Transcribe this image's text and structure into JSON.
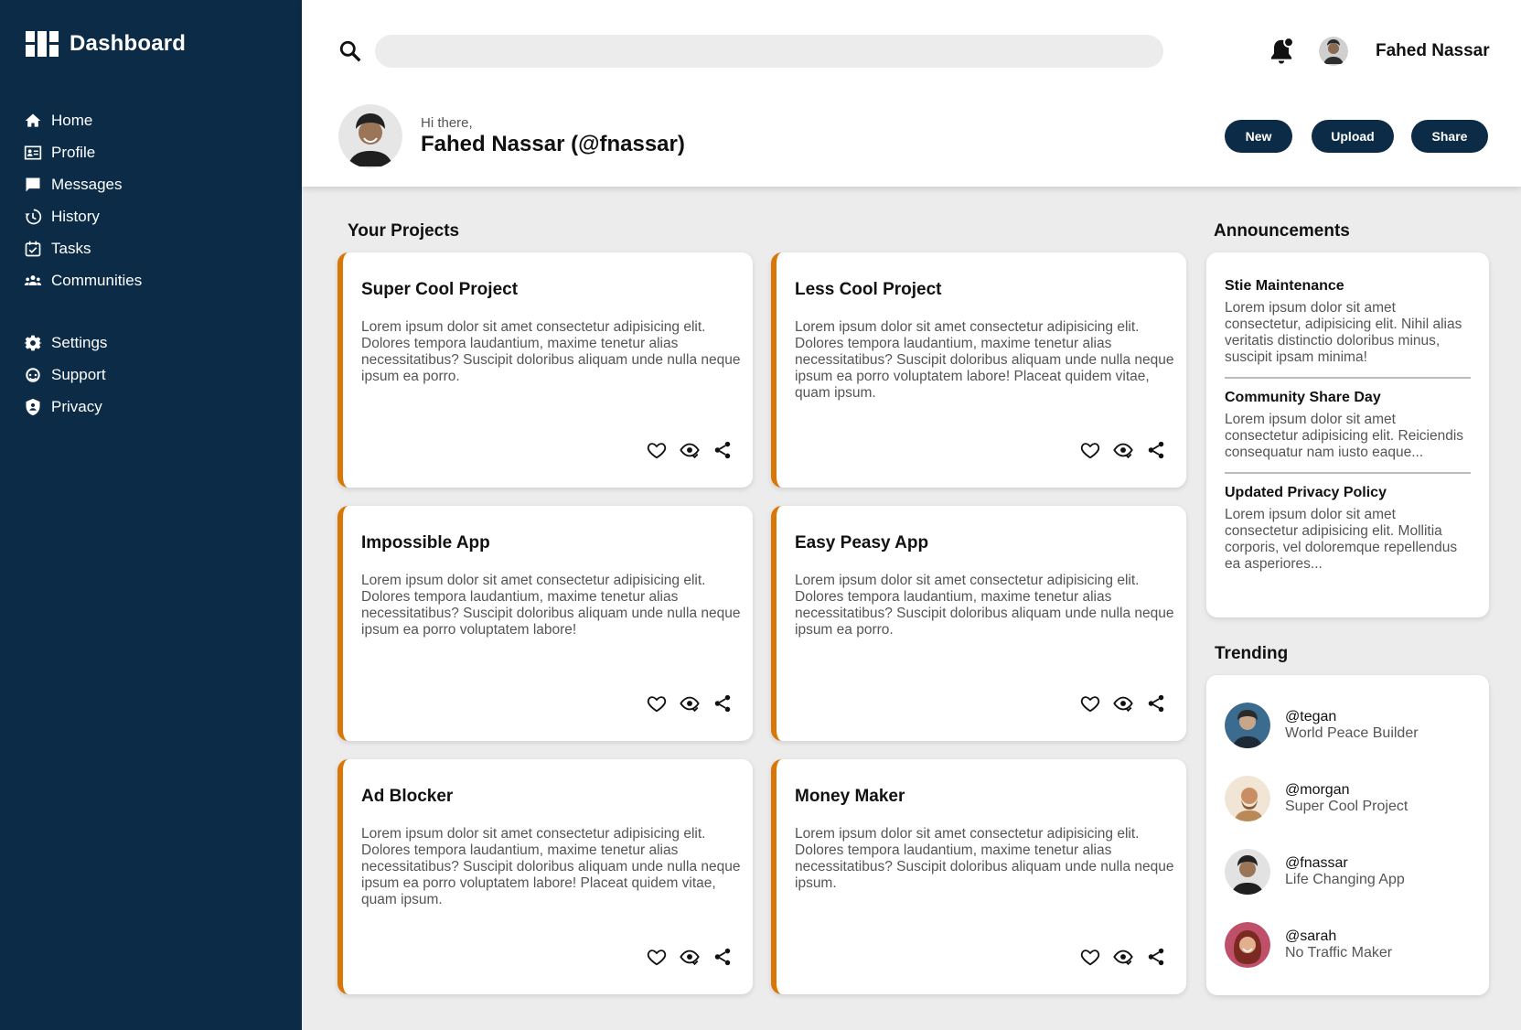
{
  "sidebar": {
    "title": "Dashboard",
    "items": [
      {
        "label": "Home",
        "icon": "home-icon"
      },
      {
        "label": "Profile",
        "icon": "profile-card-icon"
      },
      {
        "label": "Messages",
        "icon": "message-icon"
      },
      {
        "label": "History",
        "icon": "history-icon"
      },
      {
        "label": "Tasks",
        "icon": "calendar-check-icon"
      },
      {
        "label": "Communities",
        "icon": "group-icon"
      }
    ],
    "settings_items": [
      {
        "label": "Settings",
        "icon": "gear-icon"
      },
      {
        "label": "Support",
        "icon": "support-icon"
      },
      {
        "label": "Privacy",
        "icon": "shield-user-icon"
      }
    ]
  },
  "header": {
    "search_value": "",
    "user_name": "Fahed Nassar",
    "greeting": "Hi there,",
    "profile_name": "Fahed Nassar (@fnassar)",
    "buttons": {
      "new": "New",
      "upload": "Upload",
      "share": "Share"
    }
  },
  "projects": {
    "title": "Your Projects",
    "items": [
      {
        "title": "Super Cool Project",
        "description": "Lorem ipsum dolor sit amet consectetur adipisicing elit. Dolores tempora laudantium, maxime tenetur alias necessitatibus? Suscipit doloribus aliquam unde nulla neque ipsum ea porro."
      },
      {
        "title": "Less Cool Project",
        "description": "Lorem ipsum dolor sit amet consectetur adipisicing elit. Dolores tempora laudantium, maxime tenetur alias necessitatibus? Suscipit doloribus aliquam unde nulla neque ipsum ea porro voluptatem labore! Placeat quidem vitae, quam ipsum."
      },
      {
        "title": "Impossible App",
        "description": "Lorem ipsum dolor sit amet consectetur adipisicing elit. Dolores tempora laudantium, maxime tenetur alias necessitatibus? Suscipit doloribus aliquam unde nulla neque ipsum ea porro voluptatem labore!"
      },
      {
        "title": "Easy Peasy App",
        "description": "Lorem ipsum dolor sit amet consectetur adipisicing elit. Dolores tempora laudantium, maxime tenetur alias necessitatibus? Suscipit doloribus aliquam unde nulla neque ipsum ea porro."
      },
      {
        "title": "Ad Blocker",
        "description": "Lorem ipsum dolor sit amet consectetur adipisicing elit. Dolores tempora laudantium, maxime tenetur alias necessitatibus? Suscipit doloribus aliquam unde nulla neque ipsum ea porro voluptatem labore! Placeat quidem vitae, quam ipsum."
      },
      {
        "title": "Money Maker",
        "description": "Lorem ipsum dolor sit amet consectetur adipisicing elit. Dolores tempora laudantium, maxime tenetur alias necessitatibus? Suscipit doloribus aliquam unde nulla neque ipsum."
      }
    ],
    "action_icons": [
      "heart-icon",
      "eye-icon",
      "share-icon"
    ]
  },
  "announcements": {
    "title": "Announcements",
    "items": [
      {
        "title": "Stie Maintenance",
        "text": "Lorem ipsum dolor sit amet consectetur, adipisicing elit. Nihil alias veritatis distinctio doloribus minus, suscipit ipsam minima!"
      },
      {
        "title": "Community Share Day",
        "text": "Lorem ipsum dolor sit amet consectetur adipisicing elit. Reiciendis consequatur nam iusto eaque..."
      },
      {
        "title": "Updated Privacy Policy",
        "text": "Lorem ipsum dolor sit amet consectetur adipisicing elit. Mollitia corporis, vel doloremque repellendus ea asperiores..."
      }
    ]
  },
  "trending": {
    "title": "Trending",
    "items": [
      {
        "handle": "@tegan",
        "project": "World Peace Builder",
        "avatar_color": "#3b6b8f"
      },
      {
        "handle": "@morgan",
        "project": "Super Cool Project",
        "avatar_color": "#b98a57"
      },
      {
        "handle": "@fnassar",
        "project": "Life Changing App",
        "avatar_color": "#4a4a4a"
      },
      {
        "handle": "@sarah",
        "project": "No Traffic Maker",
        "avatar_color": "#c0506a"
      }
    ]
  },
  "colors": {
    "sidebar_bg": "#0b2b47",
    "accent": "#d97706",
    "button_bg": "#0b2b47",
    "page_bg": "#ececec"
  }
}
